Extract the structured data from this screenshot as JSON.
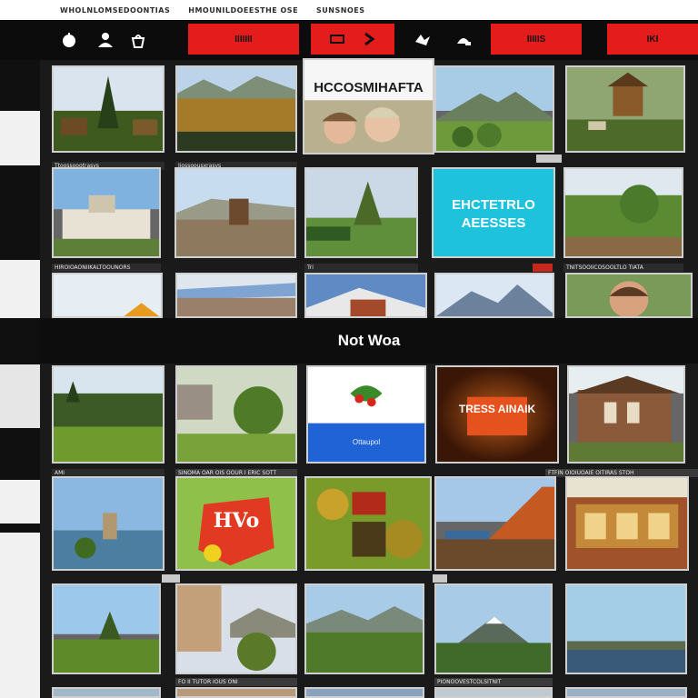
{
  "top_links": [
    "WHOLNLOMSEDOONTIAS",
    "HMOUNILDOEESTHE OSE",
    "SUNSNOES"
  ],
  "toolbar": {
    "icons": [
      "apple-icon",
      "person-icon",
      "basket-icon",
      "bird-icon",
      "hat-icon"
    ],
    "buttons": [
      "IIIIIII",
      "",
      "IIIIIS",
      "IKI"
    ]
  },
  "section": {
    "title": "Not Woa"
  },
  "tile_texts": {
    "selfie": "HCCOSMIHAFTA",
    "teal": "EHCTETRLO AEESSES",
    "food": "Ottaupol",
    "brown": "TRESS AINAIK",
    "hvo": "HVo"
  },
  "captions": {
    "row1": [
      "Ttoossoootrasvs",
      "Iiossoousxrasvs",
      "",
      "",
      ""
    ],
    "row2": [
      "HIROIOAONIIKALTOOUNORS",
      "Tri",
      "",
      "",
      "TNITSOOIICOSOOLTLO TIATA"
    ],
    "row4": [
      "AMI",
      "SINOMA OAR OIS OOUR I ERIC SOTT",
      "",
      "",
      "FTFIN OIOIUOAIE OITIRAS STOH"
    ],
    "row5": [
      "",
      "",
      "",
      "",
      ""
    ],
    "row6": [
      "",
      "FO II TUTOR  IOUS ONI",
      "",
      "PIONOOVESTCOLSITNIT",
      ""
    ]
  },
  "colors": {
    "accent": "#e41c1c",
    "bar": "#0c0c0c",
    "teal": "#1ec2dc"
  }
}
